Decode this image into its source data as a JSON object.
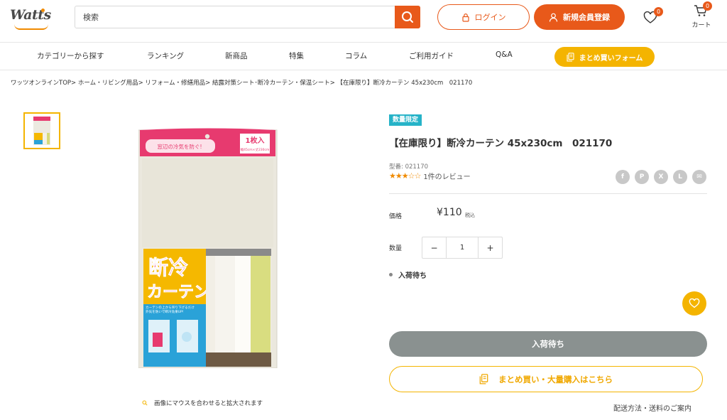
{
  "header": {
    "logo_text": "Watts",
    "search_placeholder": "検索",
    "login_label": "ログイン",
    "register_label": "新規会員登録",
    "favorites_count": "0",
    "cart_count": "0",
    "cart_label": "カート"
  },
  "nav": {
    "items": [
      "カテゴリーから探す",
      "ランキング",
      "新商品",
      "特集",
      "コラム",
      "ご利用ガイド",
      "Q&A"
    ],
    "bulk_form_label": "まとめ買いフォーム"
  },
  "breadcrumb": "ワッツオンラインTOP> ホーム・リビング用品> リフォーム・修繕用品> 結露対策シート･断冷カーテン・保温シート> 【在庫限り】断冷カーテン 45x230cm　021170",
  "gallery": {
    "zoom_hint": "画像にマウスを合わせると拡大されます",
    "package": {
      "top_banner": "窓辺の冷気を防ぐ!",
      "count_badge": "1枚入",
      "count_sub": "幅45cm×丈230cm",
      "headline_line1": "断冷",
      "headline_line2": "カーテン",
      "description_line1": "カーテンの上から吊り下げるだけ",
      "description_line2": "外気を防いで断冷効果UP!"
    }
  },
  "product": {
    "badge": "数量限定",
    "title": "【在庫限り】断冷カーテン 45x230cm　021170",
    "sku": "型番: 021170",
    "rating": 3,
    "rating_max": 5,
    "stars": "★★★☆☆",
    "review_text": "1件のレビュー",
    "price_label": "価格",
    "price": "¥110",
    "tax_label": "税込",
    "qty_label": "数量",
    "qty_value": "1",
    "qty_minus": "−",
    "qty_plus": "+",
    "stock_status": "入荷待ち",
    "cart_button": "入荷待ち",
    "bulk_button": "まとめ買い・大量購入はこちら",
    "shipping_link": "配送方法・送料のご案内"
  },
  "share": {
    "icons": [
      "facebook-icon",
      "pinterest-icon",
      "x-icon",
      "line-icon",
      "mail-icon"
    ],
    "glyphs": [
      "f",
      "P",
      "X",
      "L",
      "✉"
    ]
  },
  "colors": {
    "accent": "#e8591a",
    "yellow": "#f4b400",
    "badge_teal": "#26b3c8",
    "disabled_gray": "#8a9190",
    "star": "#f08a00"
  }
}
